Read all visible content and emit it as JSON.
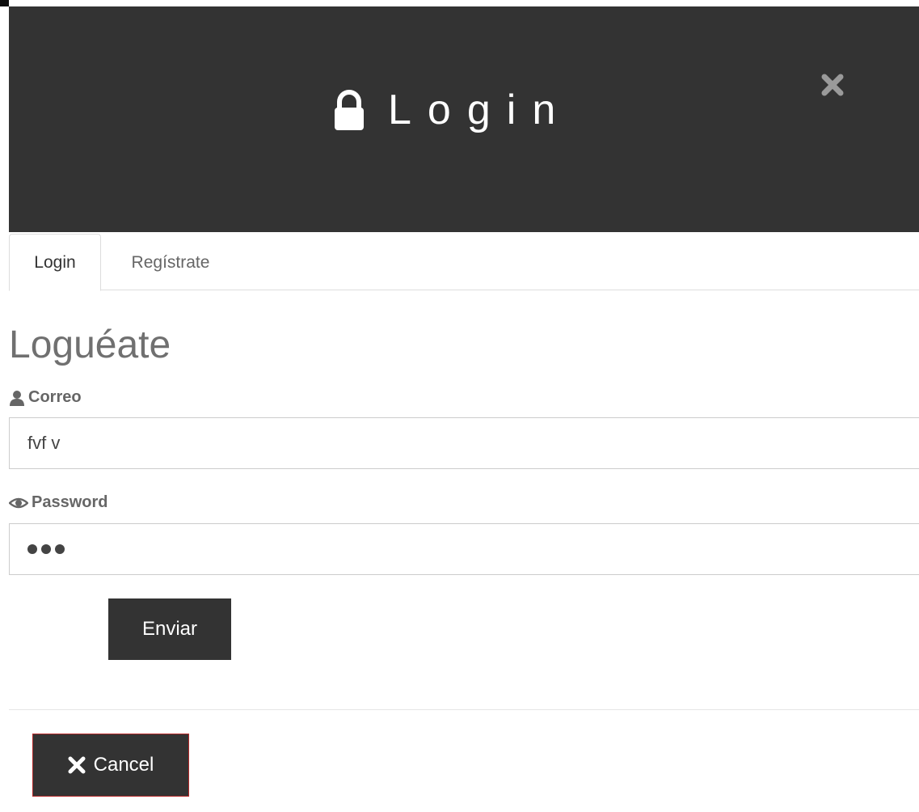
{
  "header": {
    "title": "Login",
    "lock_icon": "lock-icon",
    "close_icon": "close-icon"
  },
  "tabs": [
    {
      "label": "Login",
      "active": true
    },
    {
      "label": "Regístrate",
      "active": false
    }
  ],
  "form": {
    "heading": "Loguéate",
    "email": {
      "label": "Correo",
      "icon": "user-icon",
      "value": "fvf v"
    },
    "password": {
      "label": "Password",
      "icon": "eye-icon",
      "masked_length": 3
    },
    "submit_label": "Enviar"
  },
  "footer": {
    "cancel_label": "Cancel",
    "cancel_icon": "close-icon"
  },
  "colors": {
    "header_bg": "#333333",
    "button_bg": "#333333",
    "cancel_border": "#b52a2a",
    "text_muted": "#707070"
  }
}
